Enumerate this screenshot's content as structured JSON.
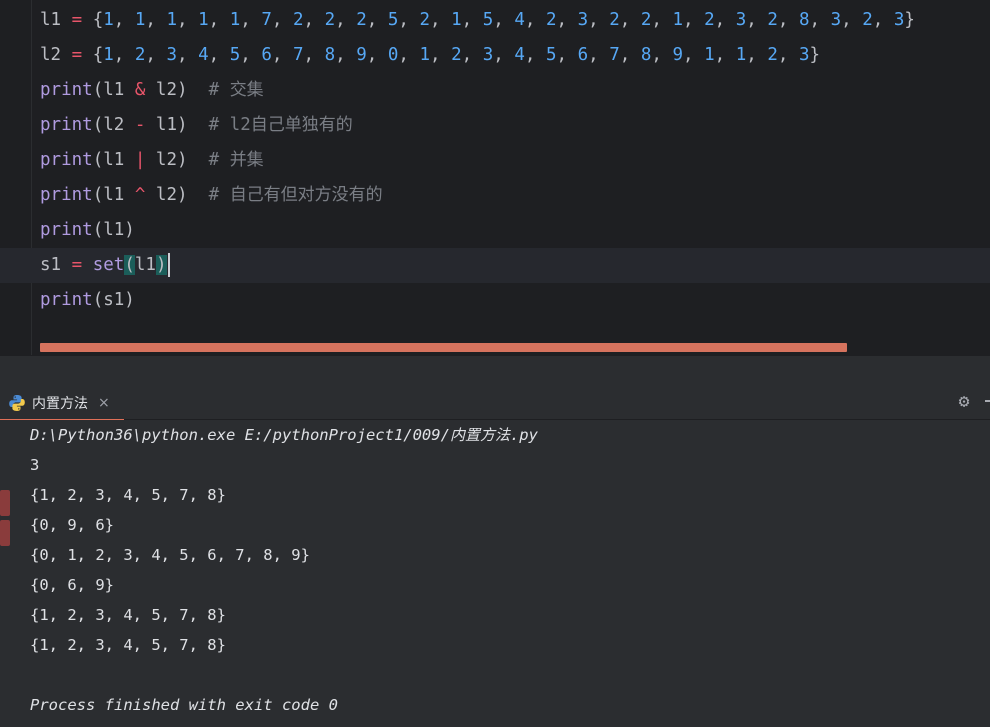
{
  "editor": {
    "lines": [
      {
        "tokens": [
          {
            "t": "l1",
            "c": "ident"
          },
          {
            "t": " ",
            "c": "punc"
          },
          {
            "t": "=",
            "c": "op"
          },
          {
            "t": " {",
            "c": "punc"
          },
          {
            "t": "1",
            "c": "num"
          },
          {
            "t": ", ",
            "c": "punc"
          },
          {
            "t": "1",
            "c": "num"
          },
          {
            "t": ", ",
            "c": "punc"
          },
          {
            "t": "1",
            "c": "num"
          },
          {
            "t": ", ",
            "c": "punc"
          },
          {
            "t": "1",
            "c": "num"
          },
          {
            "t": ", ",
            "c": "punc"
          },
          {
            "t": "1",
            "c": "num"
          },
          {
            "t": ", ",
            "c": "punc"
          },
          {
            "t": "7",
            "c": "num"
          },
          {
            "t": ", ",
            "c": "punc"
          },
          {
            "t": "2",
            "c": "num"
          },
          {
            "t": ", ",
            "c": "punc"
          },
          {
            "t": "2",
            "c": "num"
          },
          {
            "t": ", ",
            "c": "punc"
          },
          {
            "t": "2",
            "c": "num"
          },
          {
            "t": ", ",
            "c": "punc"
          },
          {
            "t": "5",
            "c": "num"
          },
          {
            "t": ", ",
            "c": "punc"
          },
          {
            "t": "2",
            "c": "num"
          },
          {
            "t": ", ",
            "c": "punc"
          },
          {
            "t": "1",
            "c": "num"
          },
          {
            "t": ", ",
            "c": "punc"
          },
          {
            "t": "5",
            "c": "num"
          },
          {
            "t": ", ",
            "c": "punc"
          },
          {
            "t": "4",
            "c": "num"
          },
          {
            "t": ", ",
            "c": "punc"
          },
          {
            "t": "2",
            "c": "num"
          },
          {
            "t": ", ",
            "c": "punc"
          },
          {
            "t": "3",
            "c": "num"
          },
          {
            "t": ", ",
            "c": "punc"
          },
          {
            "t": "2",
            "c": "num"
          },
          {
            "t": ", ",
            "c": "punc"
          },
          {
            "t": "2",
            "c": "num"
          },
          {
            "t": ", ",
            "c": "punc"
          },
          {
            "t": "1",
            "c": "num"
          },
          {
            "t": ", ",
            "c": "punc"
          },
          {
            "t": "2",
            "c": "num"
          },
          {
            "t": ", ",
            "c": "punc"
          },
          {
            "t": "3",
            "c": "num"
          },
          {
            "t": ", ",
            "c": "punc"
          },
          {
            "t": "2",
            "c": "num"
          },
          {
            "t": ", ",
            "c": "punc"
          },
          {
            "t": "8",
            "c": "num"
          },
          {
            "t": ", ",
            "c": "punc"
          },
          {
            "t": "3",
            "c": "num"
          },
          {
            "t": ", ",
            "c": "punc"
          },
          {
            "t": "2",
            "c": "num"
          },
          {
            "t": ", ",
            "c": "punc"
          },
          {
            "t": "3",
            "c": "num"
          },
          {
            "t": "}",
            "c": "punc"
          }
        ]
      },
      {
        "tokens": [
          {
            "t": "l2",
            "c": "ident"
          },
          {
            "t": " ",
            "c": "punc"
          },
          {
            "t": "=",
            "c": "op"
          },
          {
            "t": " {",
            "c": "punc"
          },
          {
            "t": "1",
            "c": "num"
          },
          {
            "t": ", ",
            "c": "punc"
          },
          {
            "t": "2",
            "c": "num"
          },
          {
            "t": ", ",
            "c": "punc"
          },
          {
            "t": "3",
            "c": "num"
          },
          {
            "t": ", ",
            "c": "punc"
          },
          {
            "t": "4",
            "c": "num"
          },
          {
            "t": ", ",
            "c": "punc"
          },
          {
            "t": "5",
            "c": "num"
          },
          {
            "t": ", ",
            "c": "punc"
          },
          {
            "t": "6",
            "c": "num"
          },
          {
            "t": ", ",
            "c": "punc"
          },
          {
            "t": "7",
            "c": "num"
          },
          {
            "t": ", ",
            "c": "punc"
          },
          {
            "t": "8",
            "c": "num"
          },
          {
            "t": ", ",
            "c": "punc"
          },
          {
            "t": "9",
            "c": "num"
          },
          {
            "t": ", ",
            "c": "punc"
          },
          {
            "t": "0",
            "c": "num"
          },
          {
            "t": ", ",
            "c": "punc"
          },
          {
            "t": "1",
            "c": "num"
          },
          {
            "t": ", ",
            "c": "punc"
          },
          {
            "t": "2",
            "c": "num"
          },
          {
            "t": ", ",
            "c": "punc"
          },
          {
            "t": "3",
            "c": "num"
          },
          {
            "t": ", ",
            "c": "punc"
          },
          {
            "t": "4",
            "c": "num"
          },
          {
            "t": ", ",
            "c": "punc"
          },
          {
            "t": "5",
            "c": "num"
          },
          {
            "t": ", ",
            "c": "punc"
          },
          {
            "t": "6",
            "c": "num"
          },
          {
            "t": ", ",
            "c": "punc"
          },
          {
            "t": "7",
            "c": "num"
          },
          {
            "t": ", ",
            "c": "punc"
          },
          {
            "t": "8",
            "c": "num"
          },
          {
            "t": ", ",
            "c": "punc"
          },
          {
            "t": "9",
            "c": "num"
          },
          {
            "t": ", ",
            "c": "punc"
          },
          {
            "t": "1",
            "c": "num"
          },
          {
            "t": ", ",
            "c": "punc"
          },
          {
            "t": "1",
            "c": "num"
          },
          {
            "t": ", ",
            "c": "punc"
          },
          {
            "t": "2",
            "c": "num"
          },
          {
            "t": ", ",
            "c": "punc"
          },
          {
            "t": "3",
            "c": "num"
          },
          {
            "t": "}",
            "c": "punc"
          }
        ]
      },
      {
        "tokens": [
          {
            "t": "print",
            "c": "fn"
          },
          {
            "t": "(l1 ",
            "c": "punc"
          },
          {
            "t": "&",
            "c": "op"
          },
          {
            "t": " l2)  ",
            "c": "punc"
          },
          {
            "t": "# ",
            "c": "cmt"
          },
          {
            "t": "交集",
            "c": "cmt-cjk"
          }
        ]
      },
      {
        "tokens": [
          {
            "t": "print",
            "c": "fn"
          },
          {
            "t": "(l2 ",
            "c": "punc"
          },
          {
            "t": "-",
            "c": "op"
          },
          {
            "t": " l1)  ",
            "c": "punc"
          },
          {
            "t": "# l2",
            "c": "cmt"
          },
          {
            "t": "自己单独有的",
            "c": "cmt-cjk"
          }
        ]
      },
      {
        "tokens": [
          {
            "t": "print",
            "c": "fn"
          },
          {
            "t": "(l1 ",
            "c": "punc"
          },
          {
            "t": "|",
            "c": "op"
          },
          {
            "t": " l2)  ",
            "c": "punc"
          },
          {
            "t": "# ",
            "c": "cmt"
          },
          {
            "t": "并集",
            "c": "cmt-cjk"
          }
        ]
      },
      {
        "tokens": [
          {
            "t": "print",
            "c": "fn"
          },
          {
            "t": "(l1 ",
            "c": "punc"
          },
          {
            "t": "^",
            "c": "op"
          },
          {
            "t": " l2)  ",
            "c": "punc"
          },
          {
            "t": "# ",
            "c": "cmt"
          },
          {
            "t": "自己有但对方没有的",
            "c": "cmt-cjk"
          }
        ]
      },
      {
        "tokens": [
          {
            "t": "print",
            "c": "fn"
          },
          {
            "t": "(l1)",
            "c": "punc"
          }
        ]
      },
      {
        "current": true,
        "tokens": [
          {
            "t": "s1",
            "c": "ident"
          },
          {
            "t": " ",
            "c": "punc"
          },
          {
            "t": "=",
            "c": "op"
          },
          {
            "t": " ",
            "c": "punc"
          },
          {
            "t": "set",
            "c": "fn"
          },
          {
            "t": "(",
            "c": "punc brace-hl"
          },
          {
            "t": "l1",
            "c": "punc"
          },
          {
            "t": ")",
            "c": "punc brace-hl"
          },
          {
            "t": "",
            "c": "caret"
          }
        ]
      },
      {
        "tokens": [
          {
            "t": "print",
            "c": "fn"
          },
          {
            "t": "(s1)",
            "c": "punc"
          }
        ]
      }
    ]
  },
  "run_panel": {
    "tab_label": "内置方法",
    "close_glyph": "×",
    "settings_glyph": "⚙"
  },
  "console": {
    "command": {
      "prefix": "D:\\Python36\\python.exe E:/pythonProject1/009/",
      "file_cjk": "内置方法",
      "suffix": ".py"
    },
    "output": [
      "3",
      "{1, 2, 3, 4, 5, 7, 8}",
      "{0, 9, 6}",
      "{0, 1, 2, 3, 4, 5, 6, 7, 8, 9}",
      "{0, 6, 9}",
      "{1, 2, 3, 4, 5, 7, 8}",
      "{1, 2, 3, 4, 5, 7, 8}",
      ""
    ],
    "exit_message": "Process finished with exit code 0"
  },
  "colors": {
    "editor_bg": "#1e1f22",
    "panel_bg": "#2b2d30",
    "number": "#57a8f5",
    "operator": "#e8556a",
    "builtin": "#b09be0",
    "comment": "#7a7e85",
    "tab_accent": "#e07058"
  }
}
